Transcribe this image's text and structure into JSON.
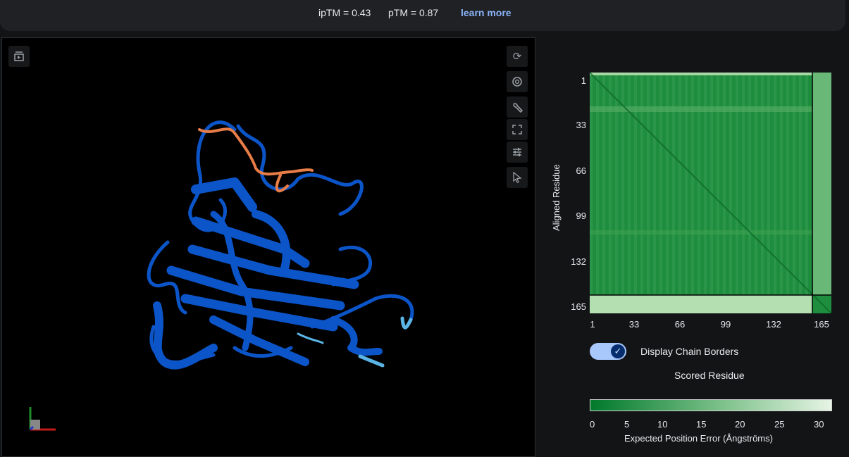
{
  "header": {
    "iptm": "ipTM = 0.43",
    "ptm": "pTM = 0.87",
    "learn_more": "learn more"
  },
  "viewer": {
    "tools": [
      "sequence-view-icon",
      "refresh-icon",
      "camera-icon",
      "wrench-icon",
      "fullscreen-icon",
      "sliders-icon",
      "cursor-icon"
    ]
  },
  "pae": {
    "y_label": "Aligned Residue",
    "y_ticks": [
      "1",
      "33",
      "66",
      "99",
      "132",
      "165"
    ],
    "x_ticks": [
      "1",
      "33",
      "66",
      "99",
      "132",
      "165"
    ],
    "toggle_label": "Display Chain Borders",
    "toggle_on": true,
    "x_label": "Scored Residue",
    "colorbar_ticks": [
      "0",
      "5",
      "10",
      "15",
      "20",
      "25",
      "30"
    ],
    "colorbar_label": "Expected Position Error (Ångströms)",
    "colors": {
      "low": "#00792b",
      "high": "#e6f4e4"
    }
  }
}
